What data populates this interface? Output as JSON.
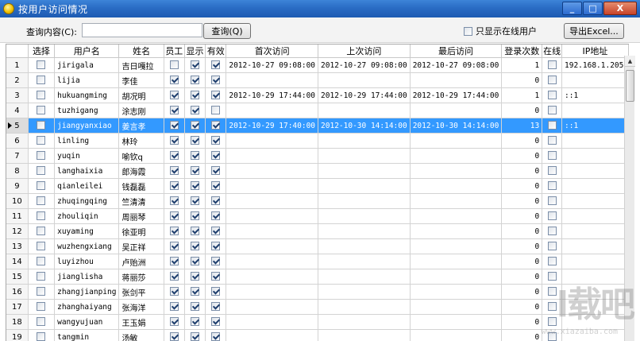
{
  "window": {
    "title": "按用户访问情况",
    "min_label": "_",
    "max_label": "□",
    "close_label": "X"
  },
  "toolbar": {
    "query_label": "查询内容(C):",
    "query_value": "",
    "query_button": "查询(Q)",
    "online_only_label": "只显示在线用户",
    "online_only_checked": false,
    "export_button": "导出Excel..."
  },
  "columns": [
    "选择",
    "用户名",
    "姓名",
    "员工",
    "显示",
    "有效",
    "首次访问",
    "上次访问",
    "最后访问",
    "登录次数",
    "在线",
    "IP地址"
  ],
  "rows": [
    {
      "n": "1",
      "user": "jirigala",
      "name": "吉日嘎拉",
      "emp": false,
      "show": true,
      "valid": true,
      "first": "2012-10-27 09:08:00",
      "prev": "2012-10-27 09:08:00",
      "last": "2012-10-27 09:08:00",
      "count": "1",
      "ip": "192.168.1.205"
    },
    {
      "n": "2",
      "user": "lijia",
      "name": "李佳",
      "emp": true,
      "show": true,
      "valid": true,
      "first": "",
      "prev": "",
      "last": "",
      "count": "0",
      "ip": ""
    },
    {
      "n": "3",
      "user": "hukuangming",
      "name": "胡况明",
      "emp": true,
      "show": true,
      "valid": true,
      "first": "2012-10-29 17:44:00",
      "prev": "2012-10-29 17:44:00",
      "last": "2012-10-29 17:44:00",
      "count": "1",
      "ip": "::1"
    },
    {
      "n": "4",
      "user": "tuzhigang",
      "name": "涂志刚",
      "emp": true,
      "show": true,
      "valid": false,
      "first": "",
      "prev": "",
      "last": "",
      "count": "0",
      "ip": ""
    },
    {
      "n": "5",
      "user": "jiangyanxiao",
      "name": "姜言孝",
      "emp": true,
      "show": true,
      "valid": true,
      "first": "2012-10-29 17:40:00",
      "prev": "2012-10-30 14:14:00",
      "last": "2012-10-30 14:14:00",
      "count": "13",
      "ip": "::1",
      "selected": true
    },
    {
      "n": "6",
      "user": "linling",
      "name": "林玲",
      "emp": true,
      "show": true,
      "valid": true,
      "first": "",
      "prev": "",
      "last": "",
      "count": "0",
      "ip": ""
    },
    {
      "n": "7",
      "user": "yuqin",
      "name": "喻钦q",
      "emp": true,
      "show": true,
      "valid": true,
      "first": "",
      "prev": "",
      "last": "",
      "count": "0",
      "ip": ""
    },
    {
      "n": "8",
      "user": "langhaixia",
      "name": "郎海霞",
      "emp": true,
      "show": true,
      "valid": true,
      "first": "",
      "prev": "",
      "last": "",
      "count": "0",
      "ip": ""
    },
    {
      "n": "9",
      "user": "qianleilei",
      "name": "钱磊磊",
      "emp": true,
      "show": true,
      "valid": true,
      "first": "",
      "prev": "",
      "last": "",
      "count": "0",
      "ip": ""
    },
    {
      "n": "10",
      "user": "zhuqingqing",
      "name": "竺清清",
      "emp": true,
      "show": true,
      "valid": true,
      "first": "",
      "prev": "",
      "last": "",
      "count": "0",
      "ip": ""
    },
    {
      "n": "11",
      "user": "zhouliqin",
      "name": "周丽琴",
      "emp": true,
      "show": true,
      "valid": true,
      "first": "",
      "prev": "",
      "last": "",
      "count": "0",
      "ip": ""
    },
    {
      "n": "12",
      "user": "xuyaming",
      "name": "徐亚明",
      "emp": true,
      "show": true,
      "valid": true,
      "first": "",
      "prev": "",
      "last": "",
      "count": "0",
      "ip": ""
    },
    {
      "n": "13",
      "user": "wuzhengxiang",
      "name": "吴正祥",
      "emp": true,
      "show": true,
      "valid": true,
      "first": "",
      "prev": "",
      "last": "",
      "count": "0",
      "ip": ""
    },
    {
      "n": "14",
      "user": "luyizhou",
      "name": "卢贻洲",
      "emp": true,
      "show": true,
      "valid": true,
      "first": "",
      "prev": "",
      "last": "",
      "count": "0",
      "ip": ""
    },
    {
      "n": "15",
      "user": "jianglisha",
      "name": "蒋丽莎",
      "emp": true,
      "show": true,
      "valid": true,
      "first": "",
      "prev": "",
      "last": "",
      "count": "0",
      "ip": ""
    },
    {
      "n": "16",
      "user": "zhangjianping",
      "name": "张剑平",
      "emp": true,
      "show": true,
      "valid": true,
      "first": "",
      "prev": "",
      "last": "",
      "count": "0",
      "ip": ""
    },
    {
      "n": "17",
      "user": "zhanghaiyang",
      "name": "张海洋",
      "emp": true,
      "show": true,
      "valid": true,
      "first": "",
      "prev": "",
      "last": "",
      "count": "0",
      "ip": ""
    },
    {
      "n": "18",
      "user": "wangyujuan",
      "name": "王玉娟",
      "emp": true,
      "show": true,
      "valid": true,
      "first": "",
      "prev": "",
      "last": "",
      "count": "0",
      "ip": ""
    },
    {
      "n": "19",
      "user": "tangmin",
      "name": "汤敏",
      "emp": true,
      "show": true,
      "valid": true,
      "first": "",
      "prev": "",
      "last": "",
      "count": "0",
      "ip": ""
    }
  ],
  "watermark": {
    "text": "l载吧",
    "sub": "www.xiazaiba.com"
  },
  "colors": {
    "titlebar": "#2a6cc4",
    "selection": "#3399ff",
    "grid_line": "#d3d3d3"
  }
}
